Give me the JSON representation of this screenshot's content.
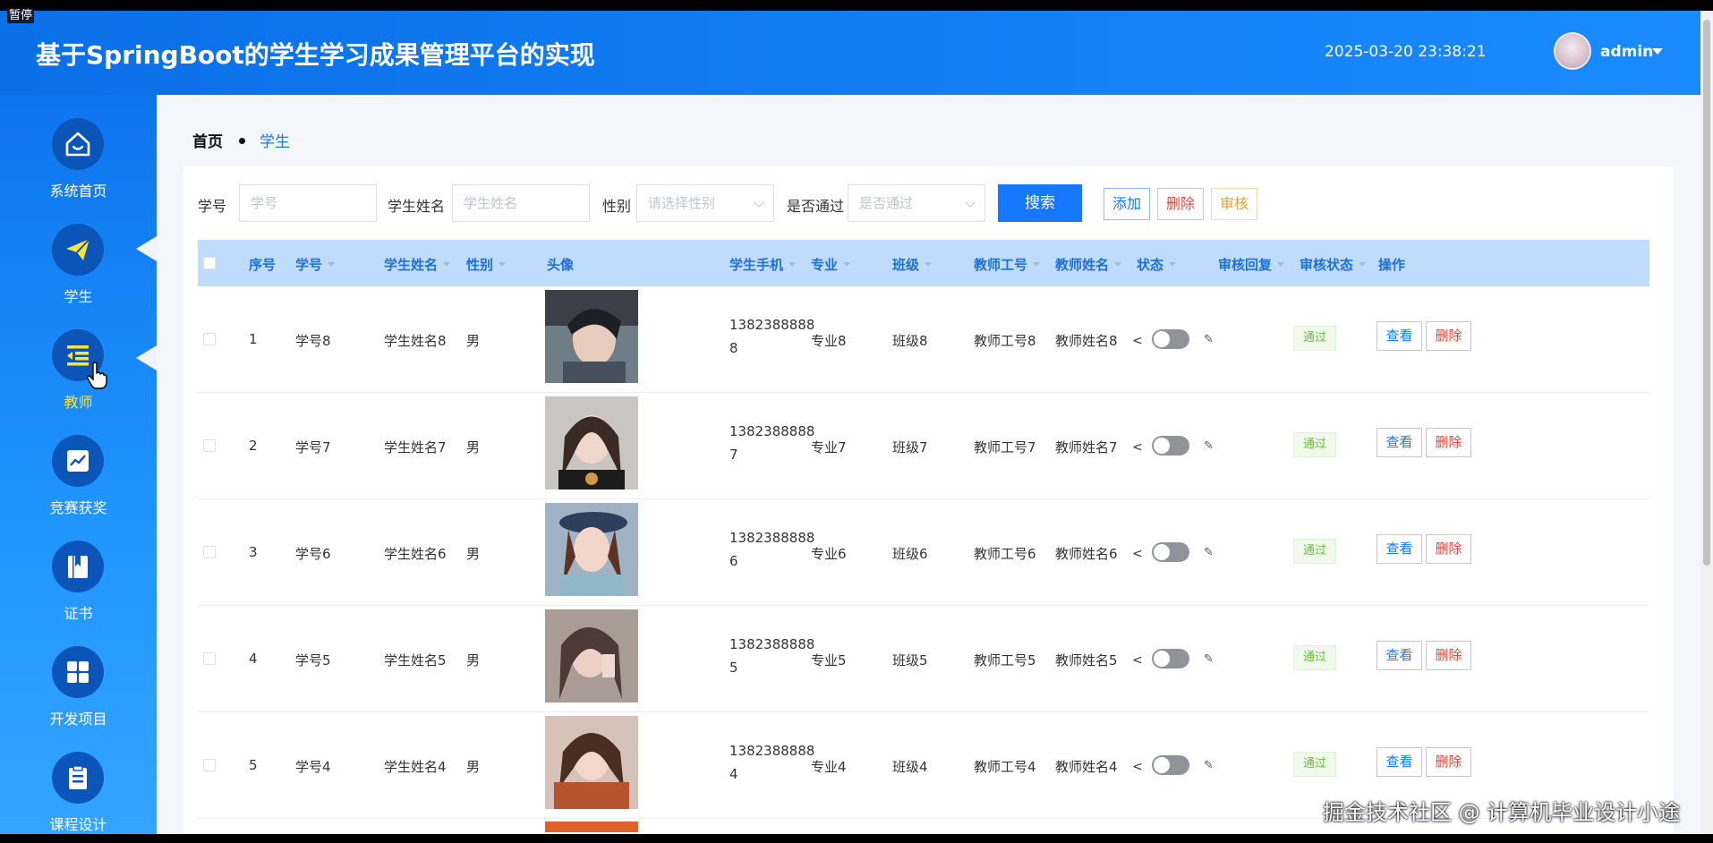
{
  "overlay": {
    "pause_label": "暂停",
    "watermark": "掘金技术社区 @ 计算机毕业设计小途"
  },
  "header": {
    "title": "基于SpringBoot的学生学习成果管理平台的实现",
    "datetime": "2025-03-20 23:38:21",
    "username": "admin",
    "avatar_icon": "user-avatar"
  },
  "sidebar": {
    "items": [
      {
        "label": "系统首页",
        "icon": "home-icon"
      },
      {
        "label": "学生",
        "icon": "paper-plane-icon"
      },
      {
        "label": "教师",
        "icon": "list-indent-icon",
        "active": true
      },
      {
        "label": "竞赛获奖",
        "icon": "trend-chart-icon"
      },
      {
        "label": "证书",
        "icon": "bookmark-icon"
      },
      {
        "label": "开发项目",
        "icon": "grid-icon"
      },
      {
        "label": "课程设计",
        "icon": "clipboard-icon"
      }
    ]
  },
  "breadcrumb": {
    "home": "首页",
    "current": "学生"
  },
  "search": {
    "student_no_label": "学号",
    "student_no_placeholder": "学号",
    "student_name_label": "学生姓名",
    "student_name_placeholder": "学生姓名",
    "gender_label": "性别",
    "gender_placeholder": "请选择性别",
    "passed_label": "是否通过",
    "passed_placeholder": "是否通过",
    "search_button": "搜索",
    "add_button": "添加",
    "delete_button": "删除",
    "review_button": "审核"
  },
  "table": {
    "headers": [
      "序号",
      "学号",
      "学生姓名",
      "性别",
      "头像",
      "学生手机",
      "专业",
      "班级",
      "教师工号",
      "教师姓名",
      "状态",
      "审核回复",
      "审核状态",
      "操作"
    ],
    "rows": [
      {
        "index": "1",
        "student_no": "学号8",
        "name": "学生姓名8",
        "gender": "男",
        "phone_line1": "1382388888",
        "phone_line2": "8",
        "major": "专业8",
        "class": "班级8",
        "teacher_no": "教师工号8",
        "teacher_name": "教师姓名8",
        "review_status": "通过",
        "view": "查看",
        "delete": "删除"
      },
      {
        "index": "2",
        "student_no": "学号7",
        "name": "学生姓名7",
        "gender": "男",
        "phone_line1": "1382388888",
        "phone_line2": "7",
        "major": "专业7",
        "class": "班级7",
        "teacher_no": "教师工号7",
        "teacher_name": "教师姓名7",
        "review_status": "通过",
        "view": "查看",
        "delete": "删除"
      },
      {
        "index": "3",
        "student_no": "学号6",
        "name": "学生姓名6",
        "gender": "男",
        "phone_line1": "1382388888",
        "phone_line2": "6",
        "major": "专业6",
        "class": "班级6",
        "teacher_no": "教师工号6",
        "teacher_name": "教师姓名6",
        "review_status": "通过",
        "view": "查看",
        "delete": "删除"
      },
      {
        "index": "4",
        "student_no": "学号5",
        "name": "学生姓名5",
        "gender": "男",
        "phone_line1": "1382388888",
        "phone_line2": "5",
        "major": "专业5",
        "class": "班级5",
        "teacher_no": "教师工号5",
        "teacher_name": "教师姓名5",
        "review_status": "通过",
        "view": "查看",
        "delete": "删除"
      },
      {
        "index": "5",
        "student_no": "学号4",
        "name": "学生姓名4",
        "gender": "男",
        "phone_line1": "1382388888",
        "phone_line2": "4",
        "major": "专业4",
        "class": "班级4",
        "teacher_no": "教师工号4",
        "teacher_name": "教师姓名4",
        "review_status": "通过",
        "view": "查看",
        "delete": "删除"
      }
    ]
  },
  "colors": {
    "primary": "#1677ff",
    "header": "#0b6fe8",
    "sidebar": "#2196ff",
    "active_label": "#ffe23a",
    "danger": "#e04a3b",
    "warning": "#e6a23c",
    "success": "#67c23a"
  }
}
